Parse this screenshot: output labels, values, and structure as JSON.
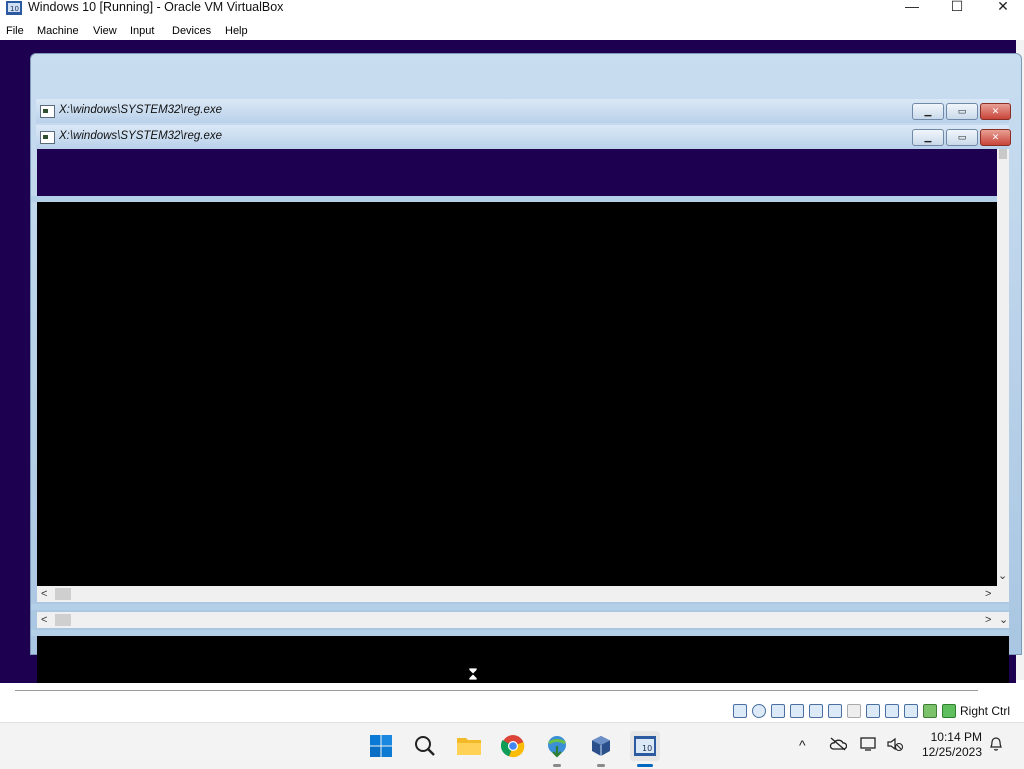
{
  "host_window": {
    "title": "Windows 10 [Running] - Oracle VM VirtualBox",
    "minimize": "—",
    "maximize": "☐",
    "close": "✕"
  },
  "menu": [
    "File",
    "Machine",
    "View",
    "Input",
    "Devices",
    "Help"
  ],
  "guest": {
    "window1_title": "X:\\windows\\SYSTEM32\\reg.exe",
    "window2_title": "X:\\windows\\SYSTEM32\\reg.exe",
    "btn_min": "▁",
    "btn_max": "▭",
    "btn_close": "✕",
    "scroll_left": "<",
    "scroll_right": ">",
    "scroll_down": "⌄"
  },
  "vbox_status": {
    "host_key": "Right Ctrl",
    "icons": [
      "hard-disk-icon",
      "optical-drive-icon",
      "floppy-icon",
      "audio-icon",
      "network-icon",
      "usb-icon",
      "shared-folders-icon",
      "display-icon",
      "video-capture-icon",
      "recording-icon",
      "cpu-icon",
      "mouse-integration-icon",
      "keyboard-icon"
    ]
  },
  "taskbar": {
    "apps": [
      "start-icon",
      "search-icon",
      "file-explorer-icon",
      "chrome-icon",
      "internet-download-manager-icon",
      "virtualbox-icon",
      "windows-10-vm-icon"
    ],
    "time": "10:14 PM",
    "date": "12/25/2023"
  },
  "colors": {
    "guest_desktop": "#1e0050",
    "win7_frame": "#b9d1ea",
    "taskbar_bg": "#f3f3f3",
    "accent": "#0067c0"
  }
}
